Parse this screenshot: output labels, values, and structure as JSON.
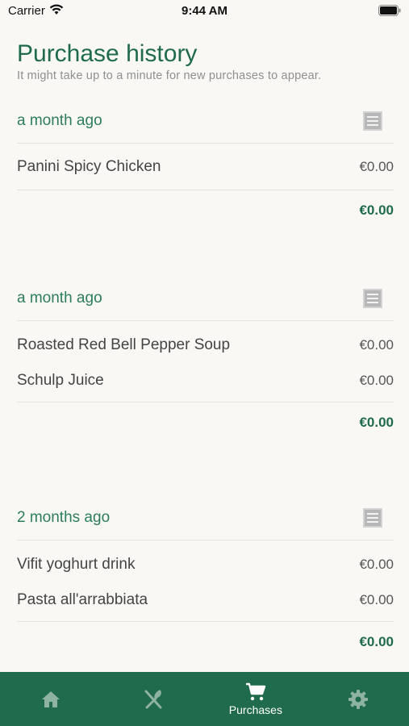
{
  "status_bar": {
    "carrier": "Carrier",
    "time": "9:44 AM"
  },
  "header": {
    "title": "Purchase history",
    "subtitle": "It might take up to a minute for new purchases to appear."
  },
  "orders": [
    {
      "date": "a month ago",
      "items": [
        {
          "name": "Panini Spicy Chicken",
          "price": "€0.00"
        }
      ],
      "total": "€0.00"
    },
    {
      "date": "a month ago",
      "items": [
        {
          "name": "Roasted Red Bell Pepper Soup",
          "price": "€0.00"
        },
        {
          "name": "Schulp Juice",
          "price": "€0.00"
        }
      ],
      "total": "€0.00"
    },
    {
      "date": "2 months ago",
      "items": [
        {
          "name": "Vifit yoghurt drink",
          "price": "€0.00"
        },
        {
          "name": "Pasta all'arrabbiata",
          "price": "€0.00"
        }
      ],
      "total": "€0.00"
    }
  ],
  "tab_bar": {
    "tabs": [
      {
        "icon": "home-icon",
        "label": ""
      },
      {
        "icon": "utensils-icon",
        "label": ""
      },
      {
        "icon": "cart-icon",
        "label": "Purchases",
        "active": true
      },
      {
        "icon": "gear-icon",
        "label": ""
      }
    ]
  },
  "colors": {
    "accent": "#1f6b4c",
    "background": "#f9f8f5",
    "tab_inactive": "#8fb3a2"
  }
}
